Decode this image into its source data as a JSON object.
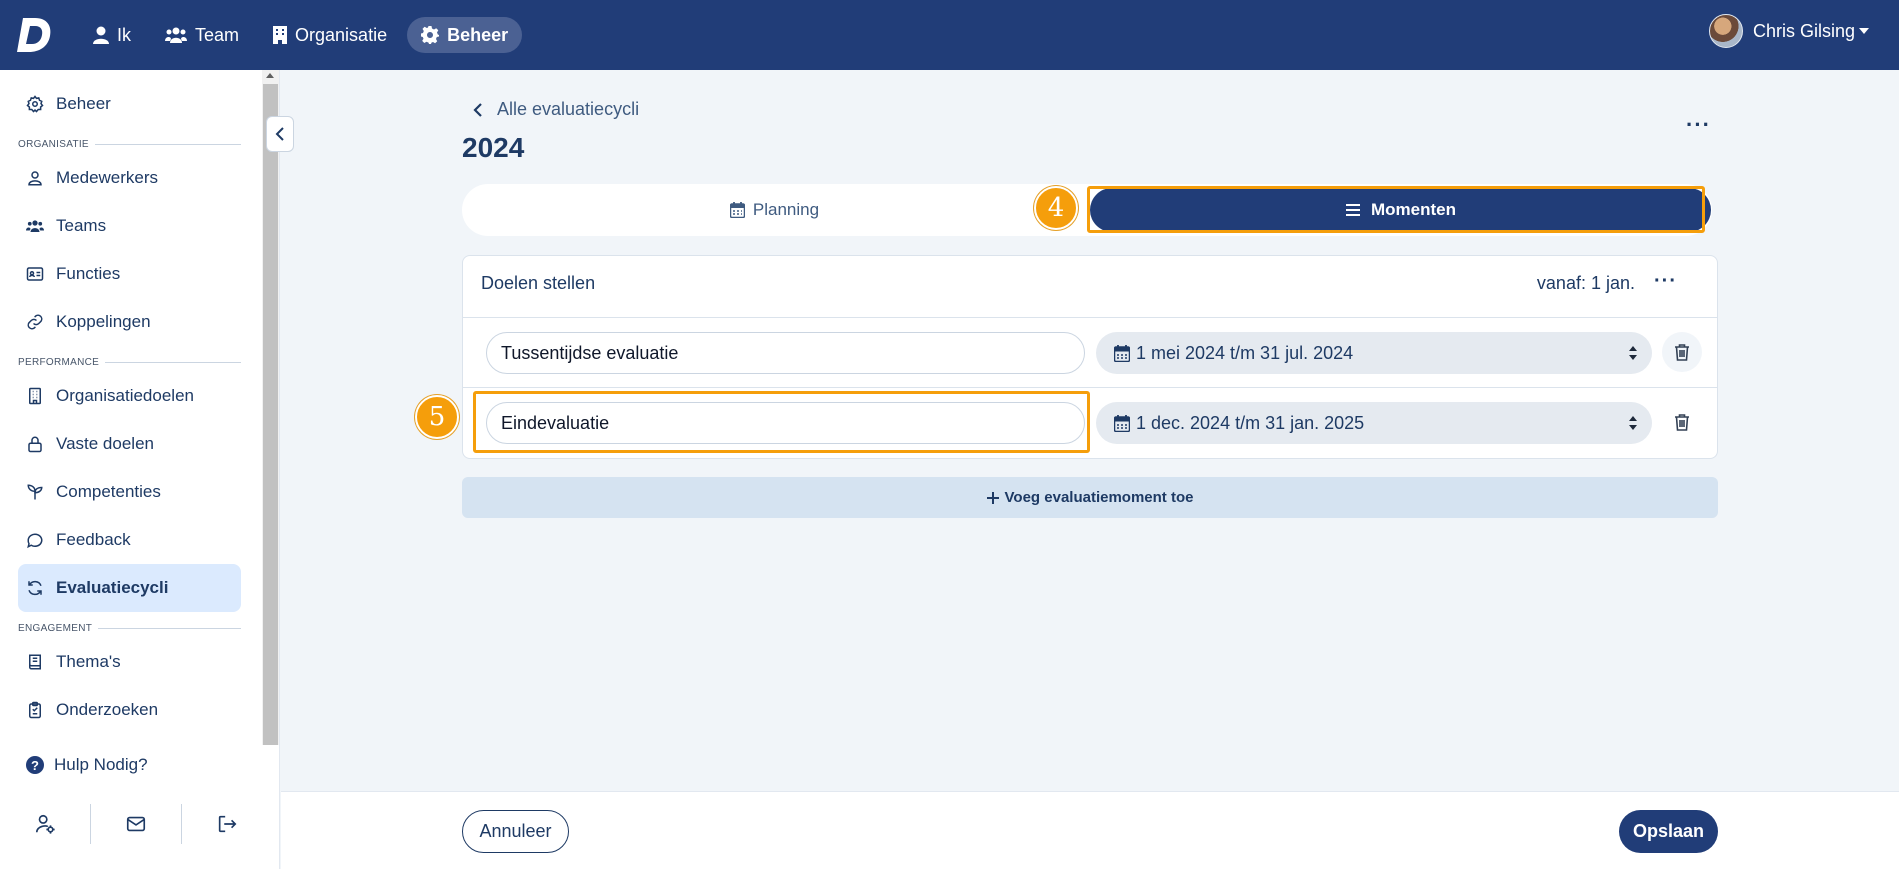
{
  "topbar": {
    "logo_letter": "D",
    "nav": [
      {
        "label": "Ik",
        "icon": "user-icon"
      },
      {
        "label": "Team",
        "icon": "users-icon"
      },
      {
        "label": "Organisatie",
        "icon": "building-icon"
      },
      {
        "label": "Beheer",
        "icon": "gear-icon",
        "active": true
      }
    ],
    "user_name": "Chris Gilsing"
  },
  "sidebar": {
    "beheer": "Beheer",
    "section_organisatie": "ORGANISATIE",
    "medewerkers": "Medewerkers",
    "teams": "Teams",
    "functies": "Functies",
    "koppelingen": "Koppelingen",
    "section_performance": "PERFORMANCE",
    "organisatiedoelen": "Organisatiedoelen",
    "vaste_doelen": "Vaste doelen",
    "competenties": "Competenties",
    "feedback": "Feedback",
    "evaluatiecycli": "Evaluatiecycli",
    "section_engagement": "ENGAGEMENT",
    "themas": "Thema's",
    "onderzoeken": "Onderzoeken",
    "help": "Hulp Nodig?",
    "help_mark": "?"
  },
  "main": {
    "back_label": "Alle evaluatiecycli",
    "title": "2024",
    "tabs": {
      "planning": "Planning",
      "momenten": "Momenten"
    },
    "card": {
      "title": "Doelen stellen",
      "from": "vanaf: 1 jan.",
      "rows": [
        {
          "name": "Tussentijdse evaluatie",
          "period": "1 mei 2024 t/m 31 jul. 2024"
        },
        {
          "name": "Eindevaluatie",
          "period": "1 dec. 2024 t/m 31 jan. 2025"
        }
      ]
    },
    "add_label": "Voeg evaluatiemoment toe",
    "badges": {
      "four": "4",
      "five": "5"
    },
    "accent_color": "#f59e0b",
    "brand_color": "#213d78"
  },
  "footer": {
    "cancel": "Annuleer",
    "save": "Opslaan"
  }
}
